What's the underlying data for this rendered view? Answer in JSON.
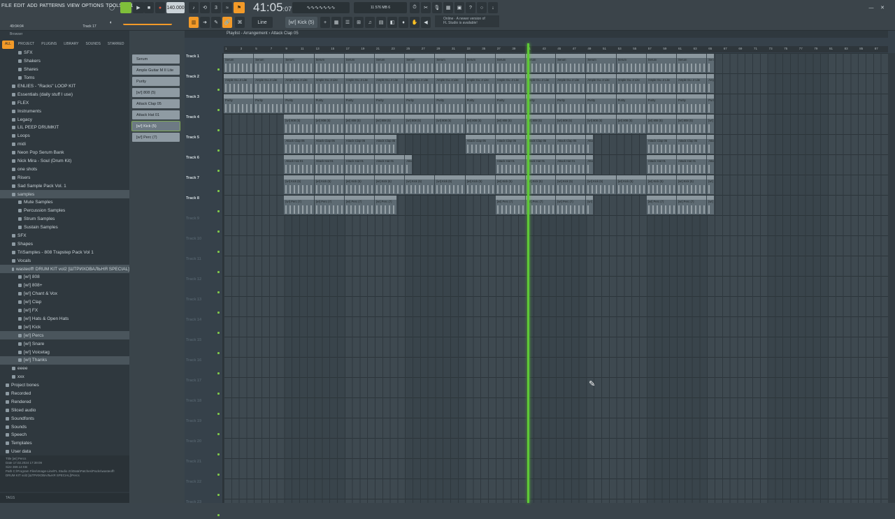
{
  "menu": [
    "FILE",
    "EDIT",
    "ADD",
    "PATTERNS",
    "VIEW",
    "OPTIONS",
    "TOOLS",
    "HELP"
  ],
  "tempo": "140.000",
  "time_main": "41:05",
  "time_sub": "07",
  "pattern": "[w!] Kick (5)",
  "snap": "Line",
  "cpu": "11",
  "mem": "576 MB",
  "voices": "6",
  "hint_lines": [
    "Online · A newer version of",
    "FL Studio is available!"
  ],
  "browser_title": "Browser",
  "browser_tabs": [
    "ALL",
    "PROJECT",
    "PLUGINS",
    "LIBRARY",
    "SOUNDS",
    "STARRED"
  ],
  "tree": [
    {
      "label": "SFX",
      "indent": 2
    },
    {
      "label": "Shakers",
      "indent": 2
    },
    {
      "label": "Shares",
      "indent": 2
    },
    {
      "label": "Toms",
      "indent": 2
    },
    {
      "label": "ENLIES - \"Racks\" LOOP KIT",
      "indent": 1
    },
    {
      "label": "Essentials (daily stuff I use)",
      "indent": 1
    },
    {
      "label": "FLEX",
      "indent": 1
    },
    {
      "label": "Instruments",
      "indent": 1
    },
    {
      "label": "Legacy",
      "indent": 1
    },
    {
      "label": "LIL PEEP DRUMKIT",
      "indent": 1
    },
    {
      "label": "Loops",
      "indent": 1
    },
    {
      "label": "midi",
      "indent": 1
    },
    {
      "label": "Neon Pop Serum Bank",
      "indent": 1
    },
    {
      "label": "Nick Mira - Soul (Drum Kit)",
      "indent": 1
    },
    {
      "label": "one shots",
      "indent": 1
    },
    {
      "label": "Risers",
      "indent": 1
    },
    {
      "label": "Sad Sample Pack Vol. 1",
      "indent": 1
    },
    {
      "label": "samples",
      "indent": 1,
      "sel": true
    },
    {
      "label": "Mute Samples",
      "indent": 2
    },
    {
      "label": "Percussion Samples",
      "indent": 2
    },
    {
      "label": "Strum Samples",
      "indent": 2
    },
    {
      "label": "Sustain Samples",
      "indent": 2
    },
    {
      "label": "SFX",
      "indent": 1
    },
    {
      "label": "Shapes",
      "indent": 1
    },
    {
      "label": "TriSamples - 808 Trapstep Pack Vol 1",
      "indent": 1
    },
    {
      "label": "Vocals",
      "indent": 1
    },
    {
      "label": "wasteoff! DRUM KIT vol2 [ШТРИХОВАЛЬНЯ SPECIAL]",
      "indent": 1,
      "sel": true
    },
    {
      "label": "[w!] 808",
      "indent": 2
    },
    {
      "label": "[w!] 808+",
      "indent": 2
    },
    {
      "label": "[w!] Chant & Vox",
      "indent": 2
    },
    {
      "label": "[w!] Clap",
      "indent": 2
    },
    {
      "label": "[w!] FX",
      "indent": 2
    },
    {
      "label": "[w!] Hats & Open Hats",
      "indent": 2
    },
    {
      "label": "[w!] Kick",
      "indent": 2
    },
    {
      "label": "[w!] Percs",
      "indent": 2,
      "sel": true
    },
    {
      "label": "[w!] Snare",
      "indent": 2
    },
    {
      "label": "[w!] Voicetag",
      "indent": 2
    },
    {
      "label": "[w!] Thanks",
      "indent": 2,
      "sel": true
    },
    {
      "label": "eeee",
      "indent": 1
    },
    {
      "label": "xxx",
      "indent": 1
    },
    {
      "label": "Project bones",
      "indent": 0
    },
    {
      "label": "Recorded",
      "indent": 0
    },
    {
      "label": "Rendered",
      "indent": 0
    },
    {
      "label": "Sliced audio",
      "indent": 0
    },
    {
      "label": "Soundfonts",
      "indent": 0
    },
    {
      "label": "Sounds",
      "indent": 0
    },
    {
      "label": "Speech",
      "indent": 0
    },
    {
      "label": "Templates",
      "indent": 0
    },
    {
      "label": "User data",
      "indent": 0
    }
  ],
  "meta": [
    "Title    [w!] Percs",
    "Date     17.02.2024 17:39:09",
    "Size     369.14 KB",
    "Path     C:\\Program Files\\Image-Line\\FL Studio 21\\Data\\Patches\\Packs\\wasteoff! DRUM KIT vol2 [ШТРИХОВАЛЬНЯ SPECIAL]\\Percs"
  ],
  "tags_label": "TAGS",
  "channels": [
    "Serum",
    "Ample Guitar M II Lite",
    "Purity",
    "[w!] 808 (5)",
    "Attack Clap 05",
    "Attack Hat 01",
    "[w!] Kick (5)",
    "[w!] Perc (7)"
  ],
  "playlist_title": "Playlist - Arrangement › Attack Clap 05",
  "tracks": [
    "Track 1",
    "Track 2",
    "Track 3",
    "Track 4",
    "Track 5",
    "Track 6",
    "Track 7",
    "Track 8",
    "Track 9",
    "Track 10",
    "Track 11",
    "Track 12",
    "Track 13",
    "Track 14",
    "Track 15",
    "Track 16",
    "Track 17",
    "Track 18",
    "Track 19",
    "Track 20",
    "Track 21",
    "Track 22",
    "Track 23"
  ],
  "ruler": [
    "1",
    "3",
    "5",
    "7",
    "9",
    "11",
    "13",
    "15",
    "17",
    "19",
    "21",
    "23",
    "25",
    "27",
    "29",
    "31",
    "33",
    "35",
    "37",
    "39",
    "41",
    "43",
    "45",
    "47",
    "49",
    "51",
    "53",
    "55",
    "57",
    "59",
    "61",
    "63",
    "65",
    "67",
    "69",
    "71",
    "73",
    "75",
    "77",
    "79",
    "81",
    "83",
    "85",
    "87"
  ],
  "clip_rows": [
    {
      "name": "Serum",
      "segs": [
        [
          1,
          24
        ],
        [
          25,
          44
        ],
        [
          45,
          65
        ]
      ]
    },
    {
      "name": "Ample Gu..2 Lite",
      "segs": [
        [
          1,
          65
        ]
      ]
    },
    {
      "name": "Purity",
      "segs": [
        [
          1,
          65
        ]
      ]
    },
    {
      "name": "[w!] 808 (5)",
      "segs": [
        [
          9,
          44
        ],
        [
          45,
          65
        ]
      ]
    },
    {
      "name": "Attack Clap 05",
      "segs": [
        [
          9,
          23
        ],
        [
          33,
          49
        ],
        [
          57,
          65
        ]
      ]
    },
    {
      "name": "Attack Hat 01",
      "segs": [
        [
          9,
          25
        ],
        [
          37,
          49
        ],
        [
          57,
          65
        ]
      ]
    },
    {
      "name": "[w!] Kick (5)",
      "segs": [
        [
          9,
          65
        ]
      ]
    },
    {
      "name": "[w!] Perc (7)",
      "segs": [
        [
          9,
          23
        ],
        [
          37,
          49
        ],
        [
          57,
          65
        ]
      ]
    }
  ]
}
